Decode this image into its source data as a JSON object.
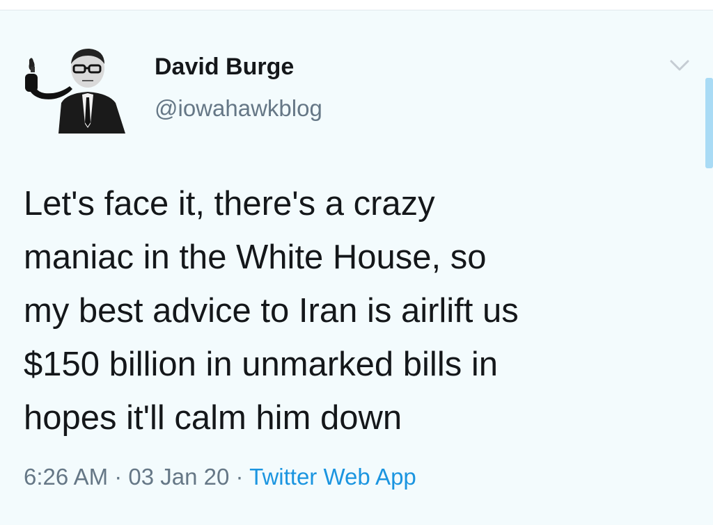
{
  "author": {
    "display_name": "David Burge",
    "handle": "@iowahawkblog"
  },
  "tweet": {
    "lines": [
      "Let's face it, there's a crazy",
      "maniac in the White House, so",
      "my best advice to Iran is airlift us",
      "$150 billion in unmarked bills in",
      "hopes it'll calm him down"
    ]
  },
  "meta": {
    "time": "6:26 AM",
    "separator": " · ",
    "date": "03 Jan 20",
    "source": "Twitter Web App"
  },
  "icons": {
    "menu": "chevron-down-icon"
  },
  "colors": {
    "background": "#f3fbfd",
    "text": "#14171a",
    "secondary": "#657786",
    "link": "#1b95e0"
  }
}
